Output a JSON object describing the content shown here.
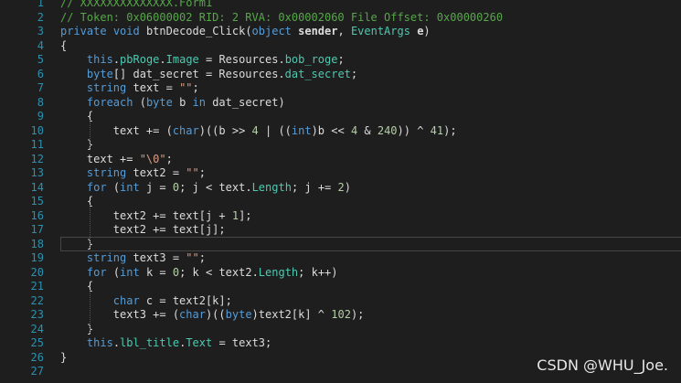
{
  "editor": {
    "lines": [
      {
        "num": "1",
        "segs": [
          {
            "c": "cm",
            "t": "// XXXXXXXXXXXXXX.Form1"
          }
        ]
      },
      {
        "num": "2",
        "segs": [
          {
            "c": "cm",
            "t": "// Token: 0x06000002 RID: 2 RVA: 0x00002060 File Offset: 0x00000260"
          }
        ]
      },
      {
        "num": "3",
        "segs": [
          {
            "c": "kw",
            "t": "private"
          },
          {
            "c": "",
            "t": " "
          },
          {
            "c": "kw",
            "t": "void"
          },
          {
            "c": "",
            "t": " btnDecode_Click("
          },
          {
            "c": "kw",
            "t": "object"
          },
          {
            "c": "bold",
            "t": " sender"
          },
          {
            "c": "",
            "t": ", "
          },
          {
            "c": "ty",
            "t": "EventArgs"
          },
          {
            "c": "bold",
            "t": " e"
          },
          {
            "c": "",
            "t": ")"
          }
        ]
      },
      {
        "num": "4",
        "segs": [
          {
            "c": "",
            "t": "{"
          }
        ]
      },
      {
        "num": "5",
        "segs": [
          {
            "c": "",
            "t": "    "
          },
          {
            "c": "kw",
            "t": "this"
          },
          {
            "c": "",
            "t": "."
          },
          {
            "c": "ty",
            "t": "pbRoge"
          },
          {
            "c": "",
            "t": "."
          },
          {
            "c": "ty",
            "t": "Image"
          },
          {
            "c": "",
            "t": " = Resources."
          },
          {
            "c": "ty",
            "t": "bob_roge"
          },
          {
            "c": "",
            "t": ";"
          }
        ]
      },
      {
        "num": "6",
        "segs": [
          {
            "c": "",
            "t": "    "
          },
          {
            "c": "kw",
            "t": "byte"
          },
          {
            "c": "",
            "t": "[] dat_secret = Resources."
          },
          {
            "c": "ty",
            "t": "dat_secret"
          },
          {
            "c": "",
            "t": ";"
          }
        ]
      },
      {
        "num": "7",
        "segs": [
          {
            "c": "",
            "t": "    "
          },
          {
            "c": "kw",
            "t": "string"
          },
          {
            "c": "",
            "t": " text = "
          },
          {
            "c": "st",
            "t": "\"\""
          },
          {
            "c": "",
            "t": ";"
          }
        ]
      },
      {
        "num": "8",
        "segs": [
          {
            "c": "",
            "t": "    "
          },
          {
            "c": "kw",
            "t": "foreach"
          },
          {
            "c": "",
            "t": " ("
          },
          {
            "c": "kw",
            "t": "byte"
          },
          {
            "c": "",
            "t": " b "
          },
          {
            "c": "kw",
            "t": "in"
          },
          {
            "c": "",
            "t": " dat_secret)"
          }
        ]
      },
      {
        "num": "9",
        "segs": [
          {
            "c": "",
            "t": "    {"
          }
        ]
      },
      {
        "num": "10",
        "segs": [
          {
            "c": "",
            "t": "        text += ("
          },
          {
            "c": "kw",
            "t": "char"
          },
          {
            "c": "",
            "t": ")((b >> "
          },
          {
            "c": "nm",
            "t": "4"
          },
          {
            "c": "",
            "t": " | (("
          },
          {
            "c": "kw",
            "t": "int"
          },
          {
            "c": "",
            "t": ")b << "
          },
          {
            "c": "nm",
            "t": "4"
          },
          {
            "c": "",
            "t": " & "
          },
          {
            "c": "nm",
            "t": "240"
          },
          {
            "c": "",
            "t": ")) ^ "
          },
          {
            "c": "nm",
            "t": "41"
          },
          {
            "c": "",
            "t": ");"
          }
        ]
      },
      {
        "num": "11",
        "segs": [
          {
            "c": "",
            "t": "    }"
          }
        ]
      },
      {
        "num": "12",
        "segs": [
          {
            "c": "",
            "t": "    text += "
          },
          {
            "c": "st",
            "t": "\"\\0\""
          },
          {
            "c": "",
            "t": ";"
          }
        ]
      },
      {
        "num": "13",
        "segs": [
          {
            "c": "",
            "t": "    "
          },
          {
            "c": "kw",
            "t": "string"
          },
          {
            "c": "",
            "t": " text2 = "
          },
          {
            "c": "st",
            "t": "\"\""
          },
          {
            "c": "",
            "t": ";"
          }
        ]
      },
      {
        "num": "14",
        "segs": [
          {
            "c": "",
            "t": "    "
          },
          {
            "c": "kw",
            "t": "for"
          },
          {
            "c": "",
            "t": " ("
          },
          {
            "c": "kw",
            "t": "int"
          },
          {
            "c": "",
            "t": " j = "
          },
          {
            "c": "nm",
            "t": "0"
          },
          {
            "c": "",
            "t": "; j < text."
          },
          {
            "c": "ty",
            "t": "Length"
          },
          {
            "c": "",
            "t": "; j += "
          },
          {
            "c": "nm",
            "t": "2"
          },
          {
            "c": "",
            "t": ")"
          }
        ]
      },
      {
        "num": "15",
        "segs": [
          {
            "c": "",
            "t": "    {"
          }
        ]
      },
      {
        "num": "16",
        "segs": [
          {
            "c": "",
            "t": "        text2 += text[j + "
          },
          {
            "c": "nm",
            "t": "1"
          },
          {
            "c": "",
            "t": "];"
          }
        ]
      },
      {
        "num": "17",
        "segs": [
          {
            "c": "",
            "t": "        text2 += text[j];"
          }
        ]
      },
      {
        "num": "18",
        "segs": [
          {
            "c": "",
            "t": "    }"
          }
        ]
      },
      {
        "num": "19",
        "segs": [
          {
            "c": "",
            "t": "    "
          },
          {
            "c": "kw",
            "t": "string"
          },
          {
            "c": "",
            "t": " text3 = "
          },
          {
            "c": "st",
            "t": "\"\""
          },
          {
            "c": "",
            "t": ";"
          }
        ]
      },
      {
        "num": "20",
        "segs": [
          {
            "c": "",
            "t": "    "
          },
          {
            "c": "kw",
            "t": "for"
          },
          {
            "c": "",
            "t": " ("
          },
          {
            "c": "kw",
            "t": "int"
          },
          {
            "c": "",
            "t": " k = "
          },
          {
            "c": "nm",
            "t": "0"
          },
          {
            "c": "",
            "t": "; k < text2."
          },
          {
            "c": "ty",
            "t": "Length"
          },
          {
            "c": "",
            "t": "; k++)"
          }
        ]
      },
      {
        "num": "21",
        "segs": [
          {
            "c": "",
            "t": "    {"
          }
        ]
      },
      {
        "num": "22",
        "segs": [
          {
            "c": "",
            "t": "        "
          },
          {
            "c": "kw",
            "t": "char"
          },
          {
            "c": "",
            "t": " c = text2[k];"
          }
        ]
      },
      {
        "num": "23",
        "segs": [
          {
            "c": "",
            "t": "        text3 += ("
          },
          {
            "c": "kw",
            "t": "char"
          },
          {
            "c": "",
            "t": ")(("
          },
          {
            "c": "kw",
            "t": "byte"
          },
          {
            "c": "",
            "t": ")text2[k] ^ "
          },
          {
            "c": "nm",
            "t": "102"
          },
          {
            "c": "",
            "t": ");"
          }
        ]
      },
      {
        "num": "24",
        "segs": [
          {
            "c": "",
            "t": "    }"
          }
        ]
      },
      {
        "num": "25",
        "segs": [
          {
            "c": "",
            "t": "    "
          },
          {
            "c": "kw",
            "t": "this"
          },
          {
            "c": "",
            "t": "."
          },
          {
            "c": "ty",
            "t": "lbl_title"
          },
          {
            "c": "",
            "t": "."
          },
          {
            "c": "ty",
            "t": "Text"
          },
          {
            "c": "",
            "t": " = text3;"
          }
        ]
      },
      {
        "num": "26",
        "segs": [
          {
            "c": "",
            "t": "}"
          }
        ]
      },
      {
        "num": "27",
        "segs": []
      }
    ],
    "current_line": "18"
  },
  "watermark": "CSDN @WHU_Joe.",
  "colors": {
    "background": "#1e1e1e",
    "line_number": "#2b91af",
    "comment": "#57a64a",
    "keyword": "#569cd6",
    "type": "#4ec9b0",
    "string": "#d69d85",
    "number": "#b5cea8",
    "plain": "#dcdcdc"
  }
}
